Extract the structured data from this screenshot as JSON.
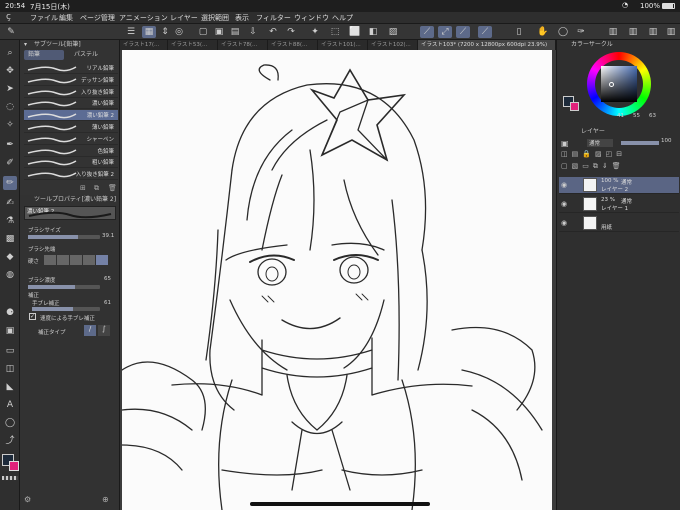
{
  "status": {
    "time": "20:54",
    "date": "7月15日(木)",
    "battery": "100%"
  },
  "menu": [
    "ファイル",
    "編集",
    "ページ管理",
    "アニメーション",
    "レイヤー",
    "選択範囲",
    "表示",
    "フィルター",
    "ウィンドウ",
    "ヘルプ"
  ],
  "tabs": [
    "イラスト17(...",
    "イラスト53(...",
    "イラスト78(...",
    "イラスト88(...",
    "イラスト101(...",
    "イラスト102(...",
    "イラスト103* (7200 x 12800px 600dpi 23.9%)"
  ],
  "subtool": {
    "title": "サブツール[鉛筆]",
    "group_tabs": [
      "鉛筆",
      "パステル"
    ],
    "brushes": [
      "リアル鉛筆",
      "デッサン鉛筆",
      "入り抜き鉛筆",
      "濃い鉛筆",
      "濃い鉛筆 2",
      "薄い鉛筆",
      "シャーペン",
      "色鉛筆",
      "粗い鉛筆",
      "入り抜き鉛筆 2"
    ],
    "selected_index": 4
  },
  "toolprop": {
    "title": "ツールプロパティ[濃い鉛筆 2]",
    "current": "濃い鉛筆 2",
    "brush_size_label": "ブラシサイズ",
    "brush_size_value": "39.1",
    "brush_size_level": 0.7,
    "brush_tip_label": "ブラシ先端",
    "hardness_label": "硬さ",
    "density_label": "ブラシ濃度",
    "density_value": "65",
    "density_level": 0.65,
    "correction_label": "補正",
    "stabilization_label": "手ブレ補正",
    "stabilization_value": "61",
    "stabilization_level": 0.6,
    "speed_stab_label": "速度による手ブレ補正",
    "correction_type_label": "補正タイプ"
  },
  "colorwheel": {
    "title": "カラーサークル",
    "h": "41",
    "s": "55",
    "v": "63"
  },
  "layers": {
    "title": "レイヤー",
    "blend": "通常",
    "opacity": "100",
    "items": [
      {
        "pct": "100 %",
        "mode": "通常",
        "name": "レイヤー 2"
      },
      {
        "pct": "23 %",
        "mode": "通常",
        "name": "レイヤー 1"
      },
      {
        "pct": "",
        "mode": "",
        "name": "用紙"
      }
    ]
  },
  "colors": {
    "accent": "#5d6a8a",
    "main_color": "#1d2a3a",
    "sub_color": "#e0207a"
  }
}
